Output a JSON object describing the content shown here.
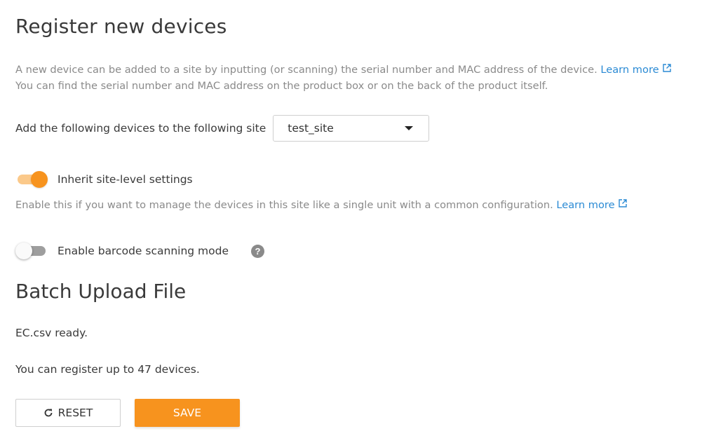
{
  "header": {
    "title": "Register new devices"
  },
  "description": {
    "line1": "A new device can be added to a site by inputting (or scanning) the serial number and MAC address of the device.",
    "learn_more": "Learn more",
    "line2": "You can find the serial number and MAC address on the product box or on the back of the product itself."
  },
  "site_select": {
    "label": "Add the following devices to the following site",
    "value": "test_site"
  },
  "inherit_settings": {
    "label": "Inherit site-level settings",
    "enabled": true,
    "description": "Enable this if you want to manage the devices in this site like a single unit with a common configuration.",
    "learn_more": "Learn more"
  },
  "barcode_mode": {
    "label": "Enable barcode scanning mode",
    "enabled": false,
    "help_icon": "?"
  },
  "batch_upload": {
    "title": "Batch Upload File",
    "file_status": "EC.csv ready.",
    "limit_text": "You can register up to 47 devices."
  },
  "actions": {
    "reset_label": "RESET",
    "save_label": "SAVE"
  },
  "icons": {
    "external_link": "external-link-icon",
    "dropdown": "chevron-down-icon",
    "help": "question-circle-icon",
    "reset": "refresh-icon"
  },
  "colors": {
    "accent": "#f7931e",
    "link": "#2a8ad4",
    "muted_text": "#8a8a8a"
  }
}
